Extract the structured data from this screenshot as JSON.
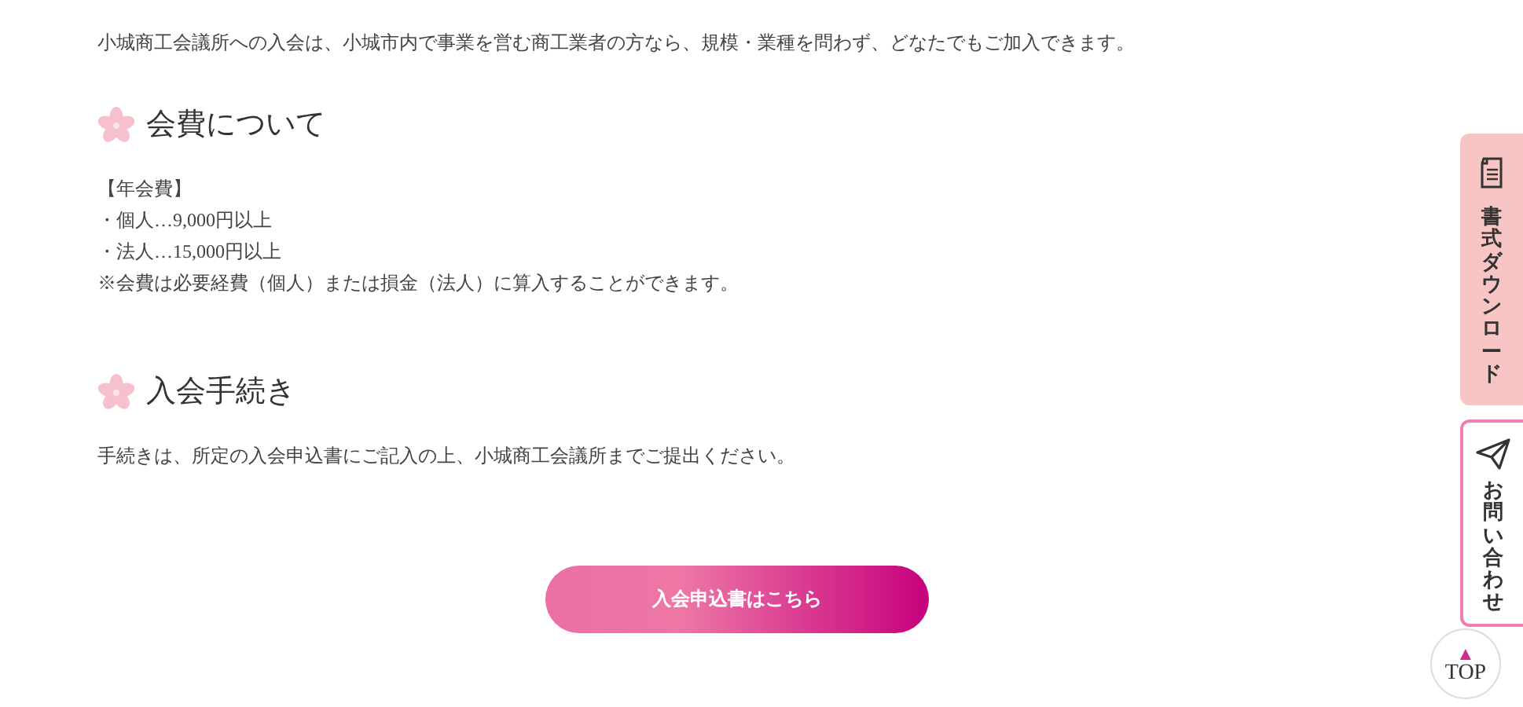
{
  "intro": "小城商工会議所への入会は、小城市内で事業を営む商工業者の方なら、規模・業種を問わず、どなたでもご加入できます。",
  "sections": [
    {
      "heading": "会費について",
      "lines": [
        "【年会費】",
        "・個人…9,000円以上",
        "・法人…15,000円以上",
        "※会費は必要経費（個人）または損金（法人）に算入することができます。"
      ]
    },
    {
      "heading": "入会手続き",
      "lines": [
        "手続きは、所定の入会申込書にご記入の上、小城商工会議所までご提出ください。"
      ]
    }
  ],
  "apply_button": "入会申込書はこちら",
  "side_tabs": [
    {
      "kind": "download",
      "label": "書式ダウンロード"
    },
    {
      "kind": "contact",
      "label": "お問い合わせ"
    }
  ],
  "top_button": {
    "arrow": "▲",
    "label": "TOP"
  }
}
